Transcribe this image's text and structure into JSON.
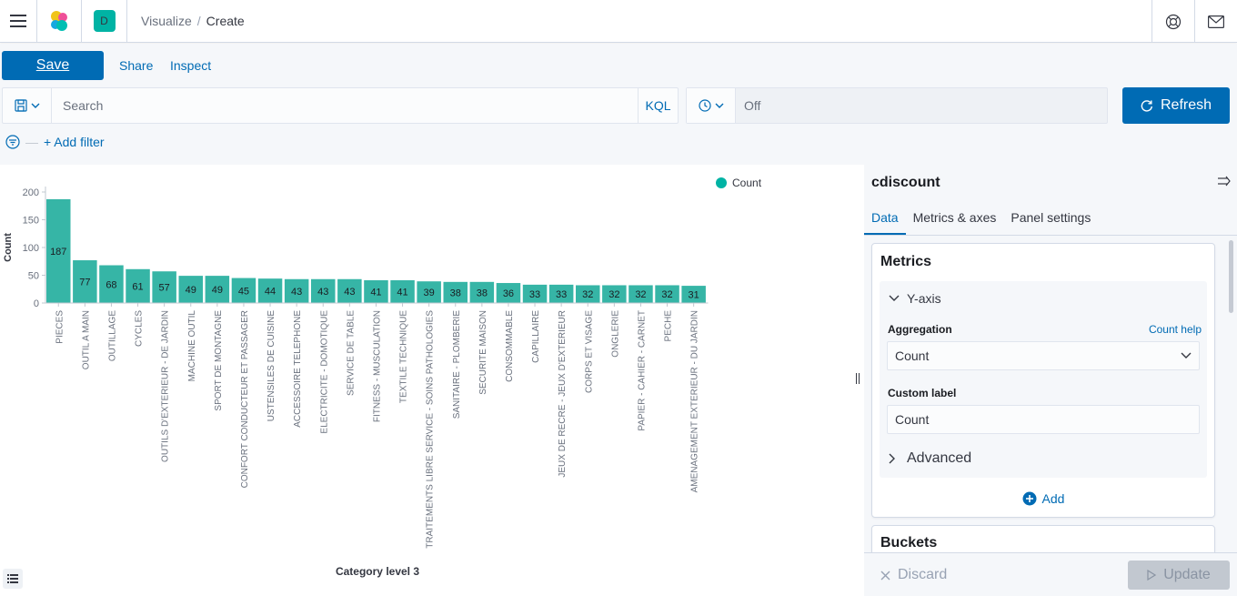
{
  "header": {
    "space_initial": "D",
    "breadcrumbs": [
      "Visualize",
      "Create"
    ],
    "breadcrumb_separator": "/"
  },
  "toolbar": {
    "save_label": "Save",
    "share_label": "Share",
    "inspect_label": "Inspect"
  },
  "query": {
    "placeholder": "Search",
    "language": "KQL"
  },
  "date": {
    "refresh_interval": "Off",
    "refresh_label": "Refresh"
  },
  "filters": {
    "add_label": "+ Add filter"
  },
  "sidebar": {
    "title": "cdiscount",
    "tabs": [
      {
        "label": "Data",
        "active": true
      },
      {
        "label": "Metrics & axes",
        "active": false
      },
      {
        "label": "Panel settings",
        "active": false
      }
    ],
    "metrics": {
      "title": "Metrics",
      "yaxis_label": "Y-axis",
      "aggregation_label": "Aggregation",
      "help_link": "Count help",
      "aggregation_value": "Count",
      "custom_label_label": "Custom label",
      "custom_label_value": "Count",
      "advanced_label": "Advanced",
      "add_label": "Add"
    },
    "buckets_title": "Buckets",
    "discard_label": "Discard",
    "update_label": "Update"
  },
  "colors": {
    "accent": "#006bb4",
    "bar": "#36b5a6",
    "teal": "#00b3a4"
  },
  "chart_data": {
    "type": "bar",
    "xlabel": "Category level 3",
    "ylabel": "Count",
    "ylim": [
      0,
      200
    ],
    "yticks": [
      0,
      50,
      100,
      150,
      200
    ],
    "legend": "top-right",
    "series": [
      {
        "name": "Count"
      }
    ],
    "categories": [
      "PIECES",
      "OUTIL A MAIN",
      "OUTILLAGE",
      "CYCLES",
      "OUTILS D'EXTERIEUR - DE JARDIN",
      "MACHINE OUTIL",
      "SPORT DE MONTAGNE",
      "CONFORT CONDUCTEUR ET PASSAGER",
      "USTENSILES DE CUISINE",
      "ACCESSOIRE TELEPHONE",
      "ELECTRICITE - DOMOTIQUE",
      "SERVICE DE TABLE",
      "FITNESS - MUSCULATION",
      "TEXTILE TECHNIQUE",
      "TRAITEMENTS LIBRE SERVICE - SOINS PATHOLOGIES",
      "SANITAIRE - PLOMBERIE",
      "SECURITE MAISON",
      "CONSOMMABLE",
      "CAPILLAIRE",
      "JEUX DE RECRE - JEUX D'EXTERIEUR",
      "CORPS ET VISAGE",
      "ONGLERIE",
      "PAPIER - CAHIER - CARNET",
      "PECHE",
      "AMENAGEMENT EXTERIEUR - DU JARDIN"
    ],
    "values": [
      187,
      77,
      68,
      61,
      57,
      49,
      49,
      45,
      44,
      43,
      43,
      43,
      41,
      41,
      39,
      38,
      38,
      36,
      33,
      33,
      32,
      32,
      32,
      32,
      31
    ]
  }
}
